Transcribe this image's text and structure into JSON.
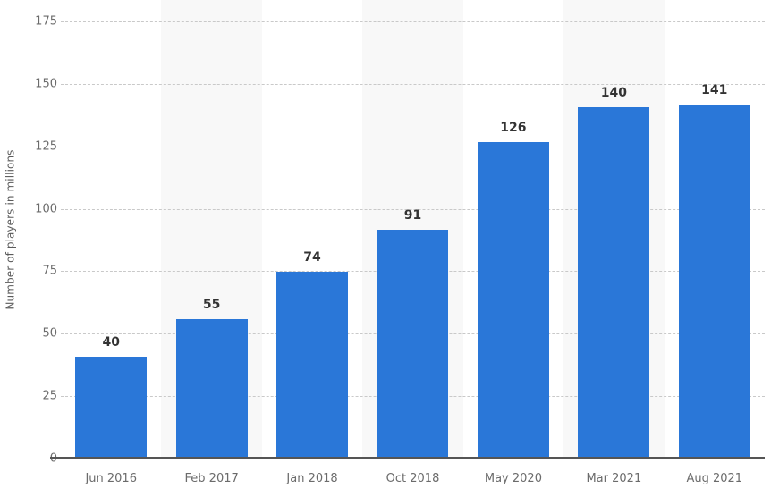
{
  "chart_data": {
    "type": "bar",
    "title": "",
    "subtitle": "",
    "xlabel": "",
    "ylabel": "Number of players in millions",
    "categories": [
      "Jun 2016",
      "Feb 2017",
      "Jan 2018",
      "Oct 2018",
      "May 2020",
      "Mar 2021",
      "Aug 2021"
    ],
    "values": [
      40,
      55,
      74,
      91,
      126,
      140,
      141
    ],
    "data_labels": [
      "40",
      "55",
      "74",
      "91",
      "126",
      "140",
      "141"
    ],
    "ylim": [
      0,
      175
    ],
    "y_ticks": [
      0,
      25,
      50,
      75,
      100,
      125,
      150,
      175
    ],
    "y_tick_labels": [
      "0",
      "25",
      "50",
      "75",
      "100",
      "125",
      "150",
      "175"
    ],
    "grid": true,
    "grid_axis": "y",
    "grid_style": "dashed",
    "legend": false,
    "legend_position": "none",
    "alternating_bands": true,
    "series": [
      {
        "name": "Number of players in millions",
        "values": [
          40,
          55,
          74,
          91,
          126,
          140,
          141
        ]
      }
    ]
  },
  "colors": {
    "bar": "#2a77d8",
    "background": "#ffffff",
    "band": "#f8f8f8",
    "gridline": "#c9c9c9",
    "axis_line": "#555555",
    "tick_label": "#6b6b6b",
    "axis_title": "#5a5a5a",
    "data_label": "#333333"
  }
}
